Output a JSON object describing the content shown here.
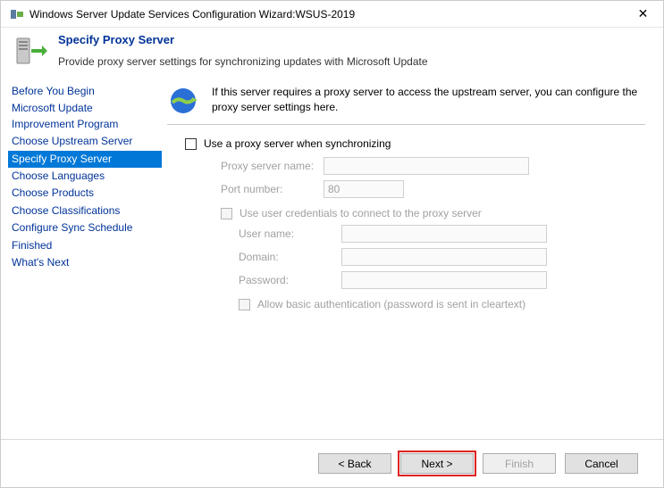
{
  "window": {
    "title": "Windows Server Update Services Configuration Wizard:WSUS-2019"
  },
  "header": {
    "title": "Specify Proxy Server",
    "subtitle": "Provide proxy server settings for synchronizing updates with Microsoft Update"
  },
  "sidebar": {
    "items": [
      "Before You Begin",
      "Microsoft Update Improvement Program",
      "Choose Upstream Server",
      "Specify Proxy Server",
      "Choose Languages",
      "Choose Products",
      "Choose Classifications",
      "Configure Sync Schedule",
      "Finished",
      "What's Next"
    ],
    "selected_index": 3
  },
  "content": {
    "intro": "If this server requires a proxy server to access the upstream server, you can configure the proxy server settings here.",
    "use_proxy_label": "Use a proxy server when synchronizing",
    "proxy_name_label": "Proxy server name:",
    "proxy_name_value": "",
    "port_label": "Port number:",
    "port_value": "80",
    "use_credentials_label": "Use user credentials to connect to the proxy server",
    "username_label": "User name:",
    "username_value": "",
    "domain_label": "Domain:",
    "domain_value": "",
    "password_label": "Password:",
    "password_value": "",
    "allow_basic_label": "Allow basic authentication (password is sent in cleartext)"
  },
  "footer": {
    "back": "< Back",
    "next": "Next >",
    "finish": "Finish",
    "cancel": "Cancel"
  }
}
